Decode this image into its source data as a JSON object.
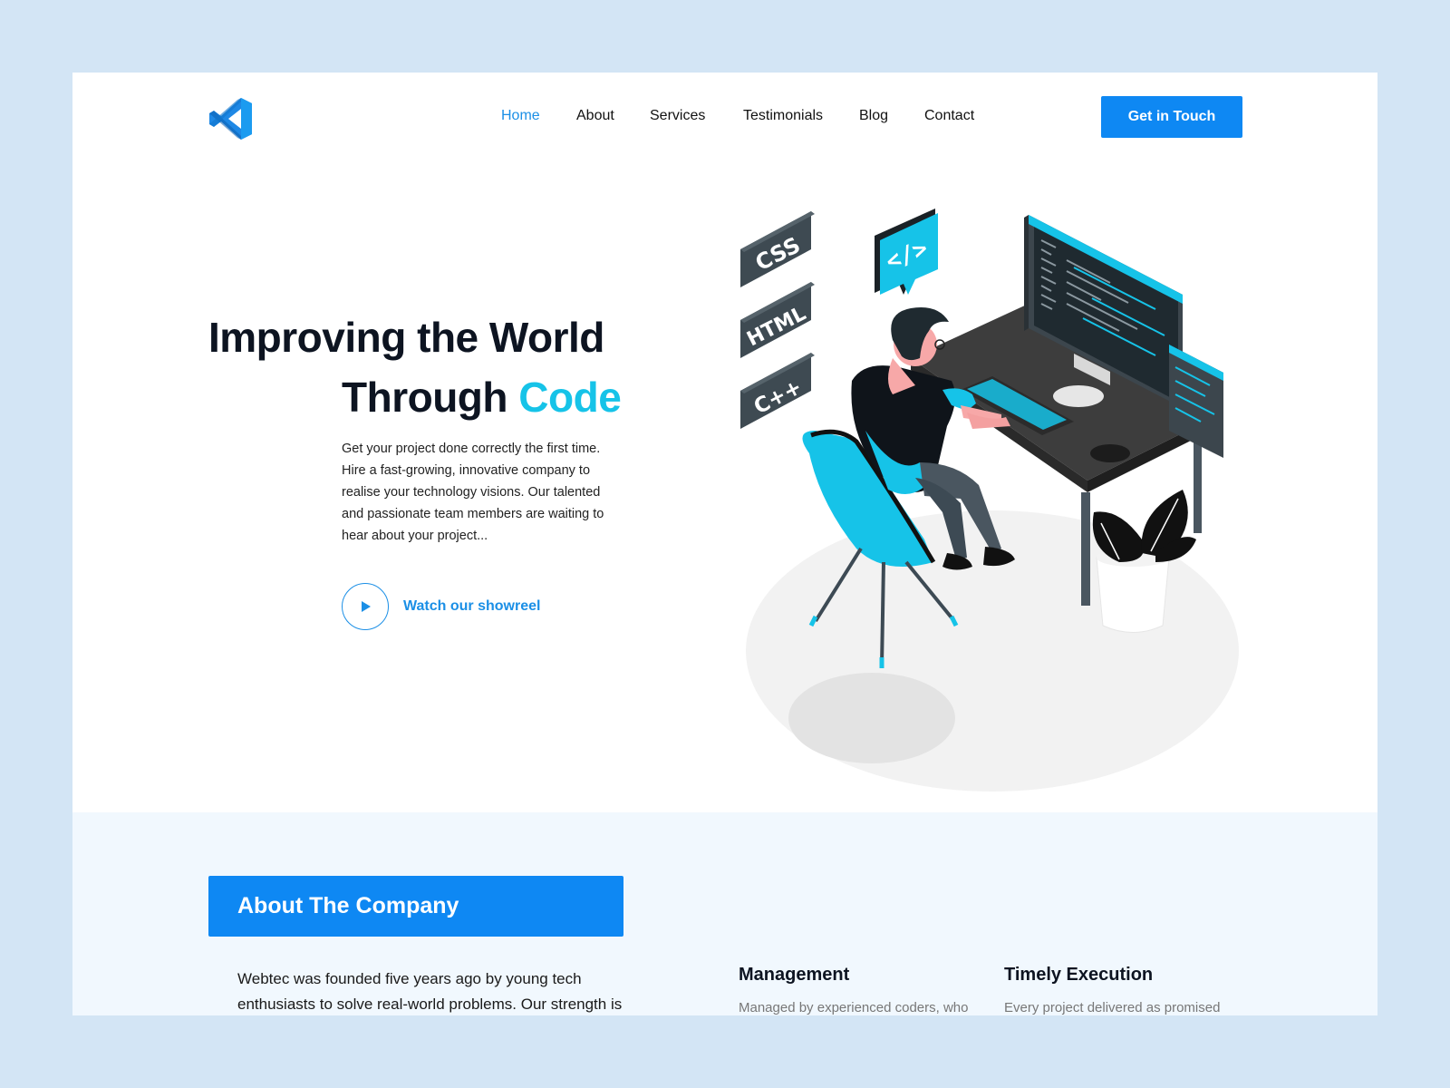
{
  "nav": {
    "items": [
      {
        "label": "Home",
        "active": true
      },
      {
        "label": "About",
        "active": false
      },
      {
        "label": "Services",
        "active": false
      },
      {
        "label": "Testimonials",
        "active": false
      },
      {
        "label": "Blog",
        "active": false
      },
      {
        "label": "Contact",
        "active": false
      }
    ],
    "cta": "Get in Touch"
  },
  "hero": {
    "title_line1": "Improving the World",
    "title_line2": "Through",
    "title_accent": "Code",
    "description": "Get your project done correctly the first time. Hire a fast-growing, innovative company to realise your technology visions. Our talented and passionate team members  are waiting to hear about your project...",
    "showreel": "Watch our showreel"
  },
  "illustration": {
    "badges": [
      "CSS",
      "HTML",
      "C++"
    ],
    "bubble_icon": "</>"
  },
  "about": {
    "banner": "About The Company",
    "text": "Webtec was founded five years ago by young tech enthusiasts to solve real-world problems. Our strength is",
    "features": [
      {
        "title": "Management",
        "desc": "Managed by experienced coders, who"
      },
      {
        "title": "Timely Execution",
        "desc": "Every project delivered as promised"
      }
    ]
  },
  "colors": {
    "page_bg": "#d3e5f5",
    "accent": "#0e88f3",
    "link": "#1b8fe6",
    "highlight": "#16c3e8",
    "section_bg": "#f1f8fe",
    "heading": "#0d1421"
  },
  "icons": {
    "logo": "vscode-logo-icon",
    "play": "play-icon"
  }
}
